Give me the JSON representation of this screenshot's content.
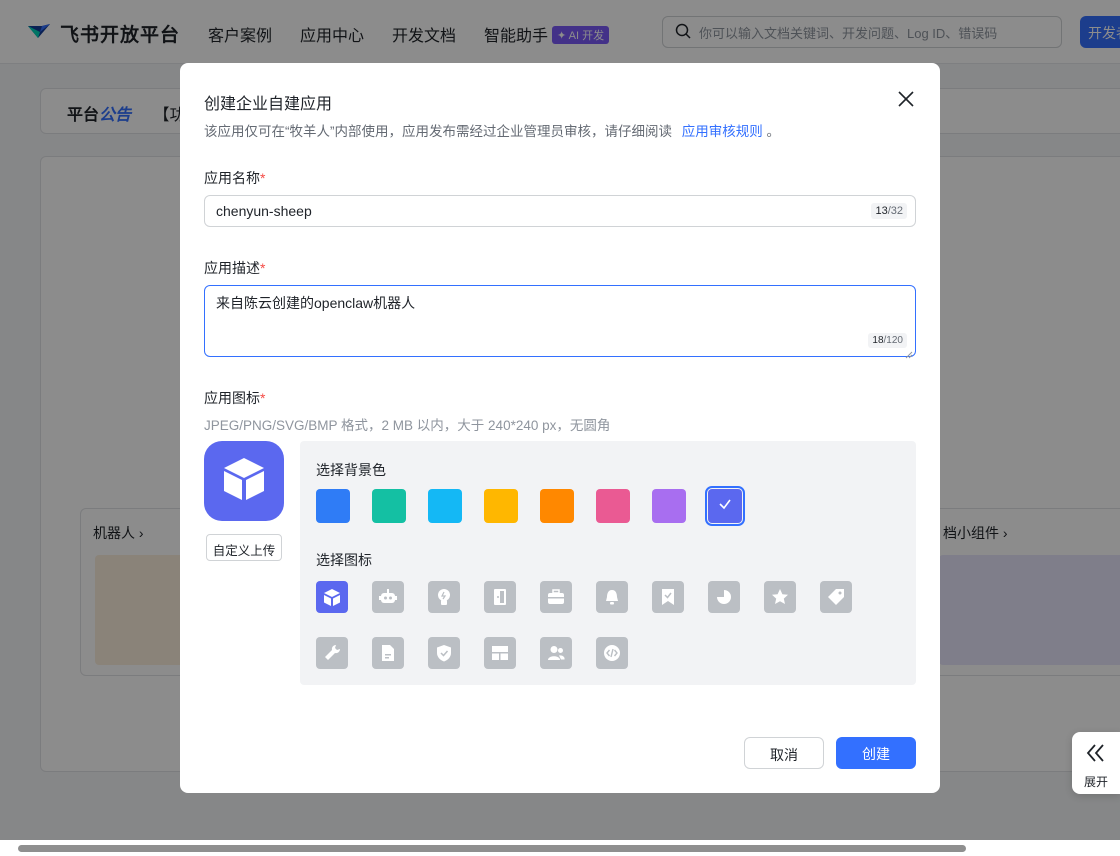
{
  "nav": {
    "brand": "飞书开放平台",
    "items": [
      "客户案例",
      "应用中心",
      "开发文档",
      "智能助手"
    ],
    "ai_badge": "✦ AI 开发",
    "search_placeholder": "你可以输入文档关键词、开发问题、Log ID、错误码",
    "dev_button": "开发者"
  },
  "background": {
    "announce_prefix": "平台",
    "announce_highlight": "公告",
    "announce_text": "【功",
    "card_left_title": "机器人 ›",
    "card_right_title": "档小组件 ›"
  },
  "modal": {
    "title": "创建企业自建应用",
    "description": "该应用仅可在“牧羊人”内部使用，应用发布需经过企业管理员审核，请仔细阅读",
    "rules_link": "应用审核规则",
    "description_end": "。",
    "name_label": "应用名称",
    "name_value": "chenyun-sheep",
    "name_count": "13",
    "name_max": "/32",
    "desc_label": "应用描述",
    "desc_value": "来自陈云创建的openclaw机器人",
    "desc_count": "18",
    "desc_max": "/120",
    "icon_label": "应用图标",
    "icon_hint": "JPEG/PNG/SVG/BMP 格式，2 MB 以内，大于 240*240 px，无圆角",
    "upload_button": "自定义上传",
    "bg_color_label": "选择背景色",
    "bg_colors": [
      "#2f7cf6",
      "#14c0a3",
      "#14b8f5",
      "#ffb700",
      "#ff8800",
      "#ea5a93",
      "#a86ef0",
      "#5b68ef"
    ],
    "selected_color_index": 7,
    "icon_select_label": "选择图标",
    "icons": [
      "cube-icon",
      "robot-icon",
      "lightbulb-icon",
      "door-icon",
      "briefcase-icon",
      "bell-icon",
      "bookmark-check-icon",
      "pie-chart-icon",
      "star-icon",
      "tag-icon",
      "wrench-icon",
      "document-icon",
      "shield-check-icon",
      "layout-icon",
      "users-icon",
      "code-icon"
    ],
    "selected_icon_index": 0,
    "cancel": "取消",
    "create": "创建",
    "required_mark": "*"
  },
  "expand_tab": {
    "label": "展开"
  }
}
